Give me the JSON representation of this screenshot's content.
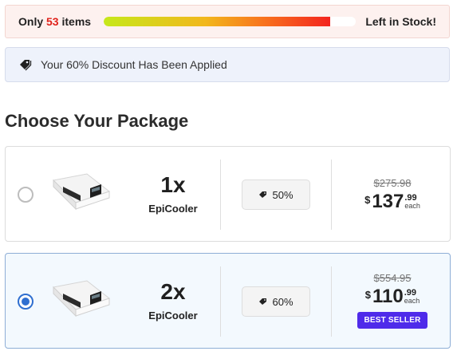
{
  "stock": {
    "prefix": "Only",
    "count": "53",
    "suffix": "items",
    "level_percent": 90,
    "right_label": "Left in Stock!"
  },
  "discount": {
    "icon": "tag-icon",
    "text": "Your 60% Discount Has Been Applied"
  },
  "heading": "Choose Your Package",
  "packages": [
    {
      "qty": "1x",
      "name": "EpiCooler",
      "discount": "50%",
      "old_price": "$275.98",
      "currency": "$",
      "price_int": "137",
      "price_cents": ".99",
      "each": "each",
      "selected": false
    },
    {
      "qty": "2x",
      "name": "EpiCooler",
      "discount": "60%",
      "old_price": "$554.95",
      "currency": "$",
      "price_int": "110",
      "price_cents": ".99",
      "each": "each",
      "badge": "BEST SELLER",
      "selected": true
    }
  ],
  "colors": {
    "stock_count": "#e0221b",
    "selected_radio": "#2f6fd0",
    "badge_bg": "#4f2bea"
  }
}
